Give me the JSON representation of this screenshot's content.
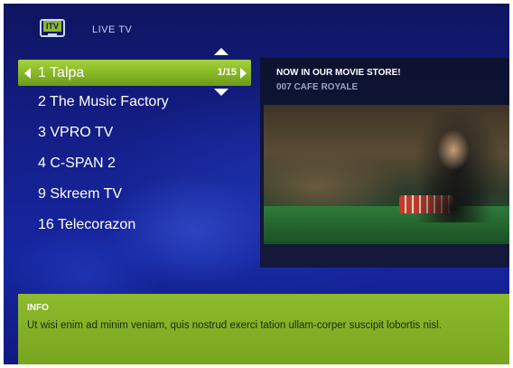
{
  "header": {
    "logo_text": "ITV",
    "section_title": "LIVE TV"
  },
  "channels": {
    "page_indicator": "1/15",
    "items": [
      {
        "label": "1 Talpa",
        "selected": true
      },
      {
        "label": "2 The Music Factory",
        "selected": false
      },
      {
        "label": "3 VPRO TV",
        "selected": false
      },
      {
        "label": "4 C-SPAN 2",
        "selected": false
      },
      {
        "label": "9 Skreem TV",
        "selected": false
      },
      {
        "label": "16 Telecorazon",
        "selected": false
      }
    ]
  },
  "promo": {
    "title": "NOW IN OUR MOVIE STORE!",
    "subtitle": "007 CAFE ROYALE"
  },
  "info": {
    "title": "INFO",
    "text": "Ut wisi enim ad minim veniam, quis nostrud exerci tation ullam-corper suscipit lobortis nisl."
  },
  "colors": {
    "accent_green": "#86b526",
    "background_blue": "#141f8a"
  }
}
